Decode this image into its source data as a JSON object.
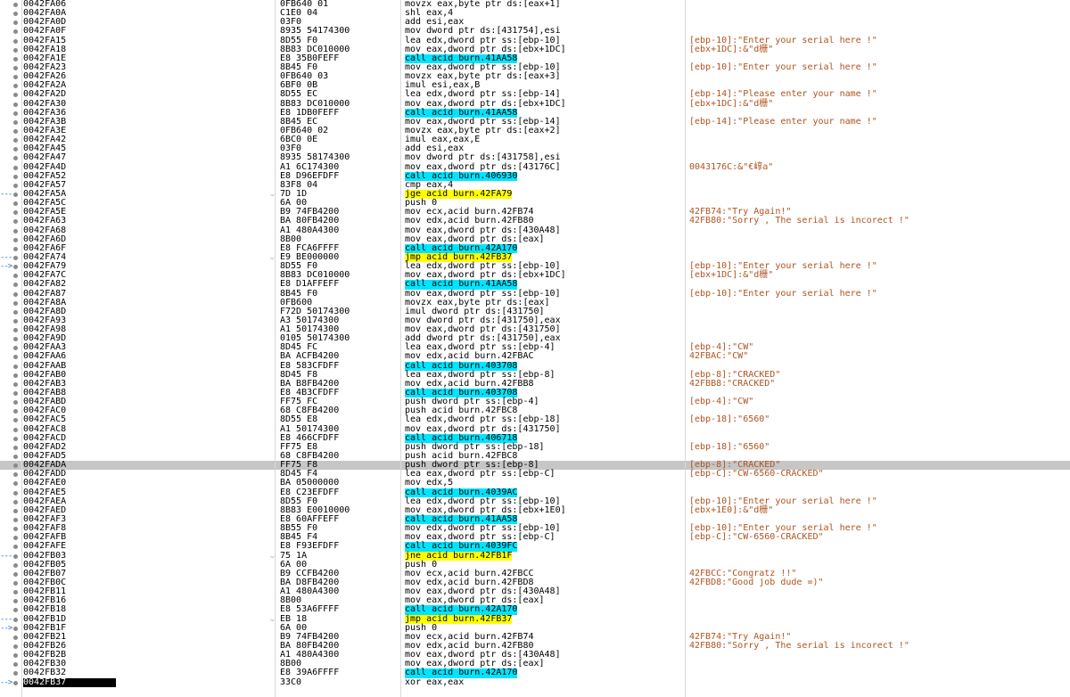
{
  "rows": [
    {
      "addr": "0042FA06",
      "bytes": "0FB640 01",
      "instr": "movzx eax,byte ptr ds:[eax+1]",
      "cmt": ""
    },
    {
      "addr": "0042FA0A",
      "bytes": "C1E0 04",
      "instr": "shl eax,4",
      "cmt": ""
    },
    {
      "addr": "0042FA0D",
      "bytes": "03F0",
      "instr": "add esi,eax",
      "cmt": ""
    },
    {
      "addr": "0042FA0F",
      "bytes": "8935 54174300",
      "instr": "mov dword ptr ds:[431754],esi",
      "cmt": ""
    },
    {
      "addr": "0042FA15",
      "bytes": "8D55 F0",
      "instr": "lea edx,dword ptr ss:[ebp-10]",
      "cmt": "[ebp-10]:\"Enter your serial here !\""
    },
    {
      "addr": "0042FA18",
      "bytes": "8B83 DC010000",
      "instr": "mov eax,dword ptr ds:[ebx+1DC]",
      "cmt": "[ebx+1DC]:&\"d栅\""
    },
    {
      "addr": "0042FA1E",
      "bytes": "E8 35B0FEFF",
      "instr": "call acid burn.41AA58",
      "cmt": "",
      "call": true
    },
    {
      "addr": "0042FA23",
      "bytes": "8B45 F0",
      "instr": "mov eax,dword ptr ss:[ebp-10]",
      "cmt": "[ebp-10]:\"Enter your serial here !\""
    },
    {
      "addr": "0042FA26",
      "bytes": "0FB640 03",
      "instr": "movzx eax,byte ptr ds:[eax+3]",
      "cmt": ""
    },
    {
      "addr": "0042FA2A",
      "bytes": "6BF0 0B",
      "instr": "imul esi,eax,B",
      "cmt": ""
    },
    {
      "addr": "0042FA2D",
      "bytes": "8D55 EC",
      "instr": "lea edx,dword ptr ss:[ebp-14]",
      "cmt": "[ebp-14]:\"Please enter your name !\""
    },
    {
      "addr": "0042FA30",
      "bytes": "8B83 DC010000",
      "instr": "mov eax,dword ptr ds:[ebx+1DC]",
      "cmt": "[ebx+1DC]:&\"d栅\""
    },
    {
      "addr": "0042FA36",
      "bytes": "E8 1DB0FEFF",
      "instr": "call acid burn.41AA58",
      "cmt": "",
      "call": true
    },
    {
      "addr": "0042FA3B",
      "bytes": "8B45 EC",
      "instr": "mov eax,dword ptr ss:[ebp-14]",
      "cmt": "[ebp-14]:\"Please enter your name !\""
    },
    {
      "addr": "0042FA3E",
      "bytes": "0FB640 02",
      "instr": "movzx eax,byte ptr ds:[eax+2]",
      "cmt": ""
    },
    {
      "addr": "0042FA42",
      "bytes": "6BC0 0E",
      "instr": "imul eax,eax,E",
      "cmt": ""
    },
    {
      "addr": "0042FA45",
      "bytes": "03F0",
      "instr": "add esi,eax",
      "cmt": ""
    },
    {
      "addr": "0042FA47",
      "bytes": "8935 58174300",
      "instr": "mov dword ptr ds:[431758],esi",
      "cmt": ""
    },
    {
      "addr": "0042FA4D",
      "bytes": "A1 6C174300",
      "instr": "mov eax,dword ptr ds:[43176C]",
      "cmt": "0043176C:&\"€崞a\""
    },
    {
      "addr": "0042FA52",
      "bytes": "E8 D96EFDFF",
      "instr": "call acid burn.406930",
      "cmt": "",
      "call": true
    },
    {
      "addr": "0042FA57",
      "bytes": "83F8 04",
      "instr": "cmp eax,4",
      "cmt": ""
    },
    {
      "addr": "0042FA5A",
      "bytes": "7D 1D",
      "instr": "jge acid burn.42FA79",
      "cmt": "",
      "jmp": true,
      "fold": true,
      "arrow": "---"
    },
    {
      "addr": "0042FA5C",
      "bytes": "6A 00",
      "instr": "push 0",
      "cmt": ""
    },
    {
      "addr": "0042FA5E",
      "bytes": "B9 74FB4200",
      "instr": "mov ecx,acid burn.42FB74",
      "cmt": "42FB74:\"Try Again!\""
    },
    {
      "addr": "0042FA63",
      "bytes": "BA 80FB4200",
      "instr": "mov edx,acid burn.42FB80",
      "cmt": "42FB80:\"Sorry , The serial is incorect !\""
    },
    {
      "addr": "0042FA68",
      "bytes": "A1 480A4300",
      "instr": "mov eax,dword ptr ds:[430A48]",
      "cmt": ""
    },
    {
      "addr": "0042FA6D",
      "bytes": "8B00",
      "instr": "mov eax,dword ptr ds:[eax]",
      "cmt": ""
    },
    {
      "addr": "0042FA6F",
      "bytes": "E8 FCA6FFFF",
      "instr": "call acid burn.42A170",
      "cmt": "",
      "call": true
    },
    {
      "addr": "0042FA74",
      "bytes": "E9 BE000000",
      "instr": "jmp acid burn.42FB37",
      "cmt": "",
      "jmp": true,
      "fold": true,
      "arrow": "---"
    },
    {
      "addr": "0042FA79",
      "bytes": "8D55 F0",
      "instr": "lea edx,dword ptr ss:[ebp-10]",
      "cmt": "[ebp-10]:\"Enter your serial here !\"",
      "arrow": "-->"
    },
    {
      "addr": "0042FA7C",
      "bytes": "8B83 DC010000",
      "instr": "mov eax,dword ptr ds:[ebx+1DC]",
      "cmt": "[ebx+1DC]:&\"d栅\""
    },
    {
      "addr": "0042FA82",
      "bytes": "E8 D1AFFEFF",
      "instr": "call acid burn.41AA58",
      "cmt": "",
      "call": true
    },
    {
      "addr": "0042FA87",
      "bytes": "8B45 F0",
      "instr": "mov eax,dword ptr ss:[ebp-10]",
      "cmt": "[ebp-10]:\"Enter your serial here !\""
    },
    {
      "addr": "0042FA8A",
      "bytes": "0FB600",
      "instr": "movzx eax,byte ptr ds:[eax]",
      "cmt": ""
    },
    {
      "addr": "0042FA8D",
      "bytes": "F72D 50174300",
      "instr": "imul dword ptr ds:[431750]",
      "cmt": ""
    },
    {
      "addr": "0042FA93",
      "bytes": "A3 50174300",
      "instr": "mov dword ptr ds:[431750],eax",
      "cmt": ""
    },
    {
      "addr": "0042FA98",
      "bytes": "A1 50174300",
      "instr": "mov eax,dword ptr ds:[431750]",
      "cmt": ""
    },
    {
      "addr": "0042FA9D",
      "bytes": "0105 50174300",
      "instr": "add dword ptr ds:[431750],eax",
      "cmt": ""
    },
    {
      "addr": "0042FAA3",
      "bytes": "8D45 FC",
      "instr": "lea eax,dword ptr ss:[ebp-4]",
      "cmt": "[ebp-4]:\"CW\""
    },
    {
      "addr": "0042FAA6",
      "bytes": "BA ACFB4200",
      "instr": "mov edx,acid burn.42FBAC",
      "cmt": "42FBAC:\"CW\""
    },
    {
      "addr": "0042FAAB",
      "bytes": "E8 583CFDFF",
      "instr": "call acid burn.403708",
      "cmt": "",
      "call": true
    },
    {
      "addr": "0042FAB0",
      "bytes": "8D45 F8",
      "instr": "lea eax,dword ptr ss:[ebp-8]",
      "cmt": "[ebp-8]:\"CRACKED\""
    },
    {
      "addr": "0042FAB3",
      "bytes": "BA B8FB4200",
      "instr": "mov edx,acid burn.42FBB8",
      "cmt": "42FBB8:\"CRACKED\""
    },
    {
      "addr": "0042FAB8",
      "bytes": "E8 4B3CFDFF",
      "instr": "call acid burn.403708",
      "cmt": "",
      "call": true
    },
    {
      "addr": "0042FABD",
      "bytes": "FF75 FC",
      "instr": "push dword ptr ss:[ebp-4]",
      "cmt": "[ebp-4]:\"CW\""
    },
    {
      "addr": "0042FAC0",
      "bytes": "68 C8FB4200",
      "instr": "push acid burn.42FBC8",
      "cmt": ""
    },
    {
      "addr": "0042FAC5",
      "bytes": "8D55 E8",
      "instr": "lea edx,dword ptr ss:[ebp-18]",
      "cmt": "[ebp-18]:\"6560\""
    },
    {
      "addr": "0042FAC8",
      "bytes": "A1 50174300",
      "instr": "mov eax,dword ptr ds:[431750]",
      "cmt": ""
    },
    {
      "addr": "0042FACD",
      "bytes": "E8 466CFDFF",
      "instr": "call acid burn.406718",
      "cmt": "",
      "call": true
    },
    {
      "addr": "0042FAD2",
      "bytes": "FF75 E8",
      "instr": "push dword ptr ss:[ebp-18]",
      "cmt": "[ebp-18]:\"6560\""
    },
    {
      "addr": "0042FAD5",
      "bytes": "68 C8FB4200",
      "instr": "push acid burn.42FBC8",
      "cmt": ""
    },
    {
      "addr": "0042FADA",
      "bytes": "FF75 F8",
      "instr": "push dword ptr ss:[ebp-8]",
      "cmt": "[ebp-8]:\"CRACKED\"",
      "sel": true
    },
    {
      "addr": "0042FADD",
      "bytes": "8D45 F4",
      "instr": "lea eax,dword ptr ss:[ebp-C]",
      "cmt": "[ebp-C]:\"CW-6560-CRACKED\""
    },
    {
      "addr": "0042FAE0",
      "bytes": "BA 05000000",
      "instr": "mov edx,5",
      "cmt": ""
    },
    {
      "addr": "0042FAE5",
      "bytes": "E8 C23EFDFF",
      "instr": "call acid burn.4039AC",
      "cmt": "",
      "call": true
    },
    {
      "addr": "0042FAEA",
      "bytes": "8D55 F0",
      "instr": "lea edx,dword ptr ss:[ebp-10]",
      "cmt": "[ebp-10]:\"Enter your serial here !\""
    },
    {
      "addr": "0042FAED",
      "bytes": "8B83 E0010000",
      "instr": "mov eax,dword ptr ds:[ebx+1E0]",
      "cmt": "[ebx+1E0]:&\"d栅\""
    },
    {
      "addr": "0042FAF3",
      "bytes": "E8 60AFFEFF",
      "instr": "call acid burn.41AA58",
      "cmt": "",
      "call": true
    },
    {
      "addr": "0042FAF8",
      "bytes": "8B55 F0",
      "instr": "mov edx,dword ptr ss:[ebp-10]",
      "cmt": "[ebp-10]:\"Enter your serial here !\""
    },
    {
      "addr": "0042FAFB",
      "bytes": "8B45 F4",
      "instr": "mov eax,dword ptr ss:[ebp-C]",
      "cmt": "[ebp-C]:\"CW-6560-CRACKED\""
    },
    {
      "addr": "0042FAFE",
      "bytes": "E8 F93EFDFF",
      "instr": "call acid burn.4039FC",
      "cmt": "",
      "call": true
    },
    {
      "addr": "0042FB03",
      "bytes": "75 1A",
      "instr": "jne acid burn.42FB1F",
      "cmt": "",
      "jmp": true,
      "fold": true,
      "arrow": "---"
    },
    {
      "addr": "0042FB05",
      "bytes": "6A 00",
      "instr": "push 0",
      "cmt": ""
    },
    {
      "addr": "0042FB07",
      "bytes": "B9 CCFB4200",
      "instr": "mov ecx,acid burn.42FBCC",
      "cmt": "42FBCC:\"Congratz !!\""
    },
    {
      "addr": "0042FB0C",
      "bytes": "BA D8FB4200",
      "instr": "mov edx,acid burn.42FBD8",
      "cmt": "42FBD8:\"Good job dude =)\""
    },
    {
      "addr": "0042FB11",
      "bytes": "A1 480A4300",
      "instr": "mov eax,dword ptr ds:[430A48]",
      "cmt": ""
    },
    {
      "addr": "0042FB16",
      "bytes": "8B00",
      "instr": "mov eax,dword ptr ds:[eax]",
      "cmt": ""
    },
    {
      "addr": "0042FB18",
      "bytes": "E8 53A6FFFF",
      "instr": "call acid burn.42A170",
      "cmt": "",
      "call": true
    },
    {
      "addr": "0042FB1D",
      "bytes": "EB 18",
      "instr": "jmp acid burn.42FB37",
      "cmt": "",
      "jmp": true,
      "fold": true,
      "arrow": "---"
    },
    {
      "addr": "0042FB1F",
      "bytes": "6A 00",
      "instr": "push 0",
      "cmt": "",
      "arrow": "-->"
    },
    {
      "addr": "0042FB21",
      "bytes": "B9 74FB4200",
      "instr": "mov ecx,acid burn.42FB74",
      "cmt": "42FB74:\"Try Again!\""
    },
    {
      "addr": "0042FB26",
      "bytes": "BA 80FB4200",
      "instr": "mov edx,acid burn.42FB80",
      "cmt": "42FB80:\"Sorry , The serial is incorect !\""
    },
    {
      "addr": "0042FB2B",
      "bytes": "A1 480A4300",
      "instr": "mov eax,dword ptr ds:[430A48]",
      "cmt": ""
    },
    {
      "addr": "0042FB30",
      "bytes": "8B00",
      "instr": "mov eax,dword ptr ds:[eax]",
      "cmt": ""
    },
    {
      "addr": "0042FB32",
      "bytes": "E8 39A6FFFF",
      "instr": "call acid burn.42A170",
      "cmt": "",
      "call": true
    },
    {
      "addr": "0042FB37",
      "bytes": "33C0",
      "instr": "xor eax,eax",
      "cmt": "",
      "cur": true,
      "arrow": "-->"
    }
  ],
  "colors": {
    "call_highlight": "#00e5ff",
    "jump_highlight": "#ffff00",
    "comment": "#b0531f",
    "selected_row": "#c6c6c6",
    "operand": "#d00000"
  }
}
